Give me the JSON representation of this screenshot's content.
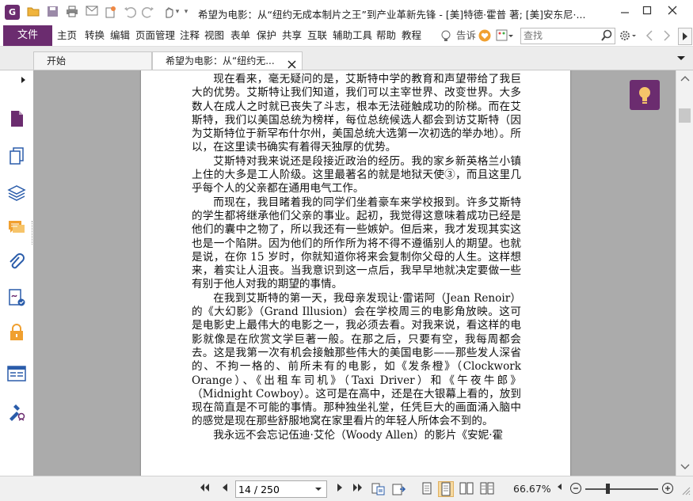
{
  "window": {
    "title": "希望为电影：从“纽约无成本制片之王”到产业革新先锋 - [美]特德·霍普 著; [美]安东尼·..."
  },
  "app": {
    "logo_letter": "G"
  },
  "menu": {
    "file": "文件",
    "items": [
      "主页",
      "转换",
      "编辑",
      "页面管理",
      "注释",
      "视图",
      "表单",
      "保护",
      "共享",
      "互联",
      "辅助工具",
      "帮助",
      "教程"
    ],
    "tell_me": "告诉",
    "search_placeholder": "查找"
  },
  "tabs": [
    {
      "label": "开始"
    },
    {
      "label": "希望为电影：从“纽约无...",
      "active": true
    }
  ],
  "document": {
    "paragraphs": [
      "现在看来，毫无疑问的是，艾斯特中学的教育和声望带给了我巨大的优势。艾斯特让我们知道，我们可以主宰世界、改变世界。大多数人在成人之时就已丧失了斗志，根本无法碰触成功的阶梯。而在艾斯特，我们以美国总统为榜样，每位总统候选人都会到访艾斯特（因为艾斯特位于新罕布什尔州，美国总统大选第一次初选的举办地）。所以，在这里读书确实有着得天独厚的优势。",
      "艾斯特对我来说还是段接近政治的经历。我的家乡新英格兰小镇上住的大多是工人阶级。这里最著名的就是地狱天使③，而且这里几乎每个人的父亲都在通用电气工作。",
      "而现在，我目睹着我的同学们坐着豪车来学校报到。许多艾斯特的学生都将继承他们父亲的事业。起初，我觉得这意味着成功已经是他们的囊中之物了，所以我还有一些嫉妒。但后来，我才发现其实这也是一个陷阱。因为他们的所作所为将不得不遵循别人的期望。也就是说，在你 15 岁时，你就知道你将来会复制你父母的人生。这样想来，着实让人沮丧。当我意识到这一点后，我早早地就决定要做一些有别于他人对我的期望的事情。",
      "在我到艾斯特的第一天，我母亲发现让·雷诺阿（Jean Renoir）的《大幻影》（Grand Illusion）会在学校周三的电影角放映。这可是电影史上最伟大的电影之一，我必须去看。对我来说，看这样的电影就像是在欣赏文学巨著一般。在那之后，只要有空，我每周都会去。这是我第一次有机会接触那些伟大的美国电影——那些发人深省的、不拘一格的、前所未有的电影，如《发条橙》（Clockwork Orange）、《出租车司机》（Taxi Driver）和《午夜牛郎》（Midnight Cowboy）。这可是在高中，还是在大银幕上看的，放到现在简直是不可能的事情。那种独坐礼堂，任凭巨大的画面涌入脑中的感觉是现在那些舒服地窝在家里看片的年轻人所体会不到的。",
      "我永远不会忘记伍迪·艾伦（Woody Allen）的影片《安妮·霍"
    ]
  },
  "status": {
    "page_value": "14 / 250",
    "zoom": "66.67%",
    "zoom_level": 0.31
  },
  "colors": {
    "brand": "#6b2c6f",
    "file_tab": "#6b2c6f",
    "accent_orange": "#f0a030"
  },
  "icons": {
    "quick_access": [
      "open-folder-icon",
      "save-icon",
      "print-icon",
      "email-icon",
      "new-icon",
      "undo-icon",
      "redo-icon",
      "hand-tool-icon",
      "customize-icon"
    ],
    "sidebar": [
      "page-thumbnail-icon",
      "layers-icon",
      "bookmarks-icon",
      "comments-icon",
      "attachments-icon",
      "signature-icon",
      "security-icon",
      "form-fields-icon",
      "accessibility-icon"
    ]
  }
}
